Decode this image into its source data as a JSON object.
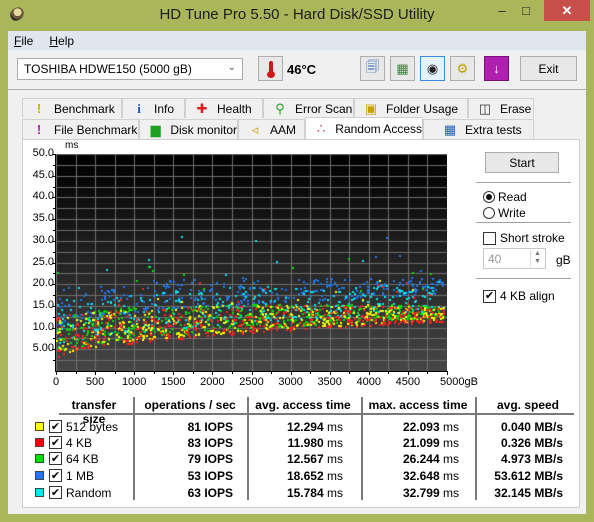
{
  "window": {
    "title": "HD Tune Pro 5.50 - Hard Disk/SSD Utility",
    "controls": {
      "minimize": "–",
      "maximize": "□",
      "close": "✕"
    }
  },
  "menu": [
    {
      "label": "File",
      "mnemonic": "F",
      "rest": "ile"
    },
    {
      "label": "Help",
      "mnemonic": "H",
      "rest": "elp"
    }
  ],
  "toolbar": {
    "drive": "TOSHIBA HDWE150 (5000 gB)",
    "temperature": "46°C",
    "buttons": [
      {
        "name": "copy-text-icon",
        "glyph": "🗐"
      },
      {
        "name": "copy-image-icon",
        "glyph": "🖼"
      },
      {
        "name": "screenshot-camera-icon",
        "glyph": "📷"
      },
      {
        "name": "options-gears-icon",
        "glyph": "⚙"
      },
      {
        "name": "save-down-arrow-icon",
        "glyph": "↓"
      }
    ],
    "exit_label": "Exit"
  },
  "tabs": {
    "row1": [
      {
        "label": "Benchmark",
        "icon": "benchmark-icon",
        "glyph": "!",
        "color": "#c8b400"
      },
      {
        "label": "Info",
        "icon": "info-icon",
        "glyph": "i",
        "color": "#1a50c8"
      },
      {
        "label": "Health",
        "icon": "health-cross-icon",
        "glyph": "✚",
        "color": "#e02020"
      },
      {
        "label": "Error Scan",
        "icon": "magnifier-icon",
        "glyph": "🔍",
        "color": "#20a020"
      },
      {
        "label": "Folder Usage",
        "icon": "folder-icon",
        "glyph": "📁",
        "color": "#c8a000"
      },
      {
        "label": "Erase",
        "icon": "trash-icon",
        "glyph": "🗑",
        "color": "#333333"
      }
    ],
    "row2": [
      {
        "label": "File Benchmark",
        "icon": "file-benchmark-icon",
        "glyph": "!",
        "color": "#b020b0"
      },
      {
        "label": "Disk monitor",
        "icon": "disk-monitor-icon",
        "glyph": "▆",
        "color": "#20a020"
      },
      {
        "label": "AAM",
        "icon": "speaker-icon",
        "glyph": "🔊",
        "color": "#c8a000"
      },
      {
        "label": "Random Access",
        "icon": "random-access-icon",
        "glyph": "∴",
        "color": "#c04040",
        "selected": true
      },
      {
        "label": "Extra tests",
        "icon": "extra-tests-icon",
        "glyph": "▦",
        "color": "#2060c0"
      }
    ]
  },
  "side_panel": {
    "start_label": "Start",
    "mode_options": [
      {
        "label": "Read",
        "selected": true
      },
      {
        "label": "Write",
        "selected": false
      }
    ],
    "short_stroke": {
      "label": "Short stroke",
      "checked": false
    },
    "short_stroke_value": "40",
    "short_stroke_unit": "gB",
    "align_4kb": {
      "label": "4 KB align",
      "checked": true
    }
  },
  "results": {
    "headers": [
      "transfer size",
      "operations / sec",
      "avg. access time",
      "max. access time",
      "avg. speed"
    ],
    "rows": [
      {
        "size": "512 bytes",
        "color": "#ffff00",
        "checked": true,
        "ops": "81",
        "ops_unit": "IOPS",
        "avg": "12.294",
        "max": "22.093",
        "time_unit": "ms",
        "speed": "0.040",
        "speed_unit": "MB/s"
      },
      {
        "size": "4 KB",
        "color": "#ff0000",
        "checked": true,
        "ops": "83",
        "ops_unit": "IOPS",
        "avg": "11.980",
        "max": "21.099",
        "time_unit": "ms",
        "speed": "0.326",
        "speed_unit": "MB/s"
      },
      {
        "size": "64 KB",
        "color": "#00e000",
        "checked": true,
        "ops": "79",
        "ops_unit": "IOPS",
        "avg": "12.567",
        "max": "26.244",
        "time_unit": "ms",
        "speed": "4.973",
        "speed_unit": "MB/s"
      },
      {
        "size": "1 MB",
        "color": "#1e78f0",
        "checked": true,
        "ops": "53",
        "ops_unit": "IOPS",
        "avg": "18.652",
        "max": "32.648",
        "time_unit": "ms",
        "speed": "53.612",
        "speed_unit": "MB/s"
      },
      {
        "size": "Random",
        "color": "#00e8f0",
        "checked": true,
        "ops": "63",
        "ops_unit": "IOPS",
        "avg": "15.784",
        "max": "32.799",
        "time_unit": "ms",
        "speed": "32.145",
        "speed_unit": "MB/s"
      }
    ]
  },
  "chart_data": {
    "type": "scatter",
    "title": "",
    "xlabel": "gB",
    "ylabel": "ms",
    "xlim": [
      0,
      5000
    ],
    "ylim": [
      0,
      50
    ],
    "x_ticks": [
      "0",
      "500",
      "1000",
      "1500",
      "2000",
      "2500",
      "3000",
      "3500",
      "4000",
      "4500",
      "5000gB"
    ],
    "y_ticks": [
      "5.00",
      "10.0",
      "15.0",
      "20.0",
      "25.0",
      "30.0",
      "35.0",
      "40.0",
      "45.0",
      "50.0"
    ],
    "grid": true,
    "x_extent_of_data": 4950,
    "series": [
      {
        "name": "512 bytes",
        "color": "#ffff00",
        "avg_ms": 12.294,
        "max_ms": 22.093,
        "min_ms_at_start": 3.0,
        "min_ms_at_end": 12.0,
        "points": 420
      },
      {
        "name": "4 KB",
        "color": "#ff2020",
        "avg_ms": 11.98,
        "max_ms": 21.099,
        "min_ms_at_start": 2.5,
        "min_ms_at_end": 11.5,
        "points": 420
      },
      {
        "name": "64 KB",
        "color": "#00e000",
        "avg_ms": 12.567,
        "max_ms": 26.244,
        "min_ms_at_start": 3.5,
        "min_ms_at_end": 12.5,
        "points": 420
      },
      {
        "name": "1 MB",
        "color": "#1e78f0",
        "avg_ms": 18.652,
        "max_ms": 32.648,
        "min_ms_at_start": 10.0,
        "min_ms_at_end": 18.0,
        "points": 330
      },
      {
        "name": "Random",
        "color": "#00e8f0",
        "avg_ms": 15.784,
        "max_ms": 32.799,
        "min_ms_at_start": 5.0,
        "min_ms_at_end": 14.0,
        "points": 360
      }
    ]
  }
}
